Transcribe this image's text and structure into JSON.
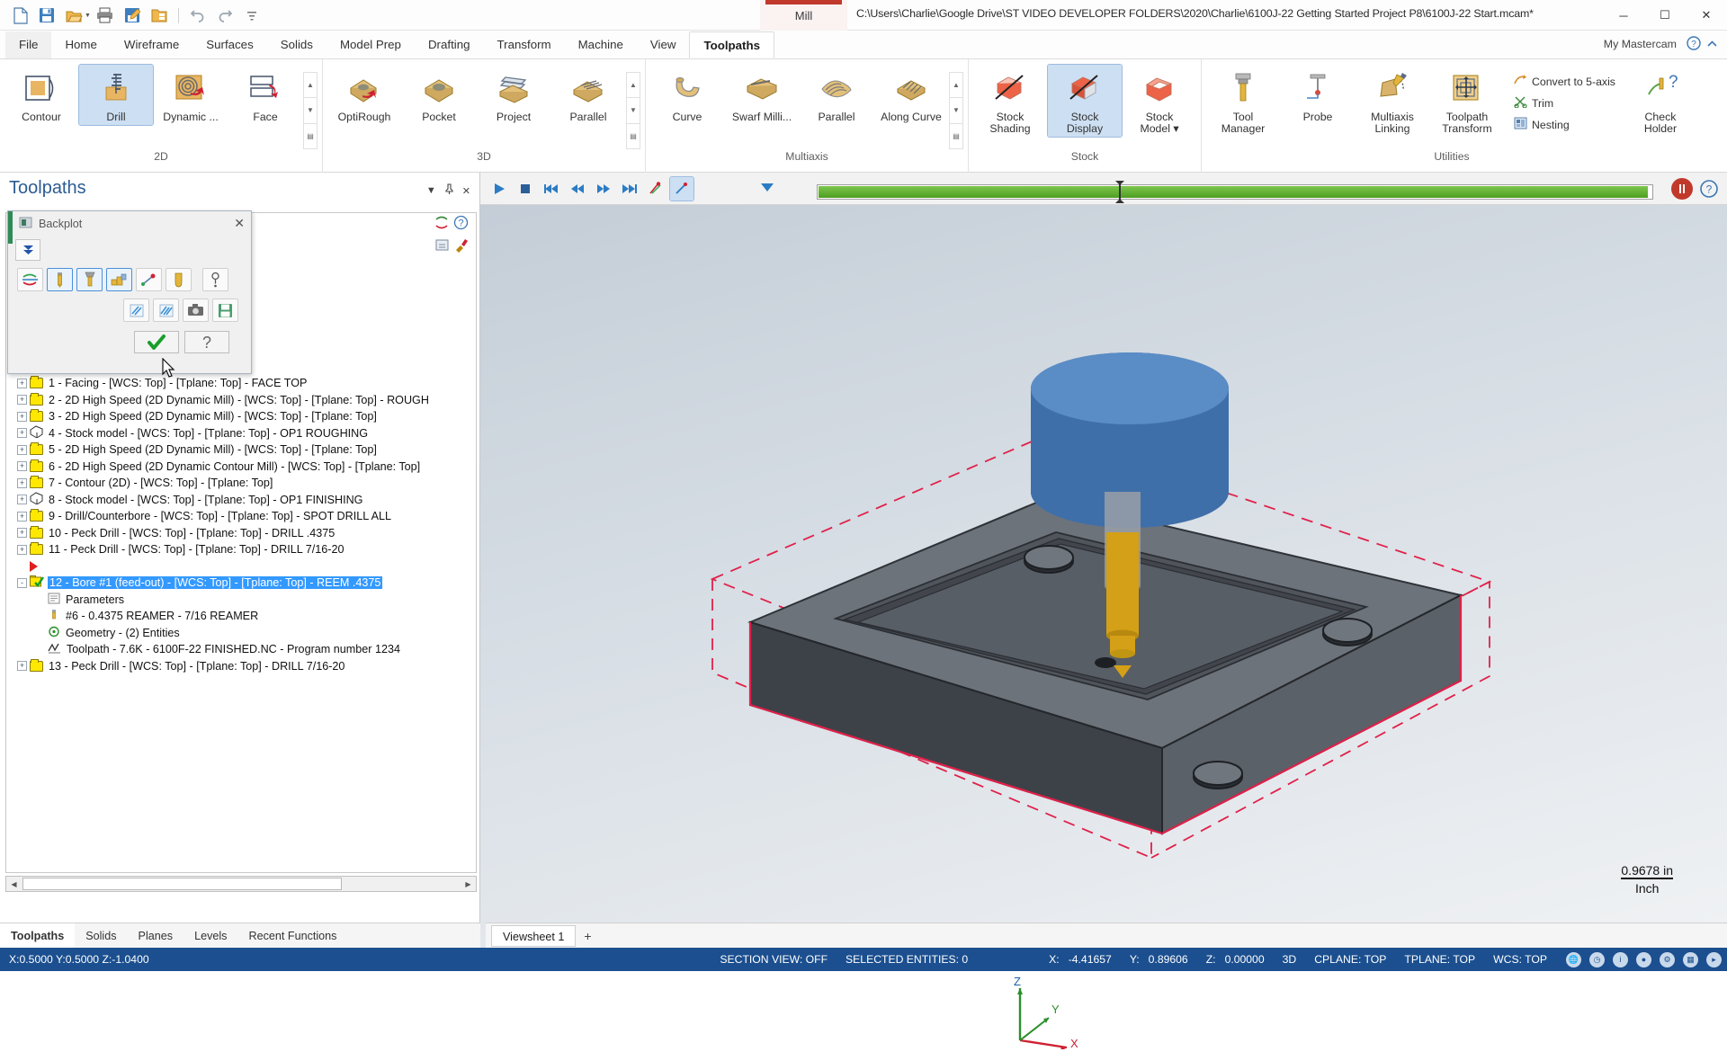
{
  "titlebar": {
    "quick_access": [
      "new-icon",
      "save-icon",
      "open-icon",
      "print-icon",
      "save-as-icon",
      "folder-manage-icon",
      "undo-icon",
      "redo-icon",
      "customize-icon"
    ],
    "mill_tab": "Mill",
    "document_path": "C:\\Users\\Charlie\\Google Drive\\ST VIDEO DEVELOPER FOLDERS\\2020\\Charlie\\6100J-22 Getting Started Project P8\\6100J-22 Start.mcam*",
    "minimize": "─",
    "maximize": "☐",
    "close": "✕"
  },
  "ribbon_tabs": [
    {
      "label": "File",
      "state": "file"
    },
    {
      "label": "Home",
      "state": "normal"
    },
    {
      "label": "Wireframe",
      "state": "normal"
    },
    {
      "label": "Surfaces",
      "state": "normal"
    },
    {
      "label": "Solids",
      "state": "normal"
    },
    {
      "label": "Model Prep",
      "state": "normal"
    },
    {
      "label": "Drafting",
      "state": "normal"
    },
    {
      "label": "Transform",
      "state": "normal"
    },
    {
      "label": "Machine",
      "state": "normal"
    },
    {
      "label": "View",
      "state": "normal"
    },
    {
      "label": "Toolpaths",
      "state": "active"
    }
  ],
  "my_mastercam": "My Mastercam",
  "ribbon_groups": [
    {
      "name": "2D",
      "buttons": [
        {
          "label": "Contour",
          "icon": "contour-icon",
          "selected": false
        },
        {
          "label": "Drill",
          "icon": "drill-icon",
          "selected": true
        },
        {
          "label": "Dynamic ...",
          "icon": "dynamic-mill-icon",
          "selected": false
        },
        {
          "label": "Face",
          "icon": "face-icon",
          "selected": false
        }
      ],
      "has_spinner": true
    },
    {
      "name": "3D",
      "buttons": [
        {
          "label": "OptiRough",
          "icon": "optirough-icon",
          "selected": false
        },
        {
          "label": "Pocket",
          "icon": "pocket-icon",
          "selected": false
        },
        {
          "label": "Project",
          "icon": "project-icon",
          "selected": false
        },
        {
          "label": "Parallel",
          "icon": "parallel-icon",
          "selected": false
        }
      ],
      "has_spinner": true
    },
    {
      "name": "Multiaxis",
      "buttons": [
        {
          "label": "Curve",
          "icon": "curve-icon",
          "selected": false
        },
        {
          "label": "Swarf Milli...",
          "icon": "swarf-milling-icon",
          "selected": false
        },
        {
          "label": "Parallel",
          "icon": "multiaxis-parallel-icon",
          "selected": false
        },
        {
          "label": "Along Curve",
          "icon": "along-curve-icon",
          "selected": false
        }
      ],
      "has_spinner": true
    },
    {
      "name": "Stock",
      "buttons": [
        {
          "label": "Stock Shading",
          "icon": "stock-shading-icon",
          "selected": false
        },
        {
          "label": "Stock Display",
          "icon": "stock-display-icon",
          "selected": true
        },
        {
          "label": "Stock Model ▾",
          "icon": "stock-model-icon",
          "selected": false
        }
      ],
      "has_spinner": false
    },
    {
      "name": "Utilities",
      "buttons": [
        {
          "label": "Tool Manager",
          "icon": "tool-manager-icon",
          "selected": false
        },
        {
          "label": "Probe",
          "icon": "probe-icon",
          "selected": false
        },
        {
          "label": "Multiaxis Linking",
          "icon": "multiaxis-linking-icon",
          "selected": false
        },
        {
          "label": "Toolpath Transform",
          "icon": "toolpath-transform-icon",
          "selected": false
        }
      ],
      "small_items": [
        {
          "label": "Convert to 5-axis",
          "icon": "convert-5axis-icon"
        },
        {
          "label": "Trim",
          "icon": "trim-icon"
        },
        {
          "label": "Nesting",
          "icon": "nesting-icon"
        }
      ],
      "extra_buttons": [
        {
          "label": "Check Holder",
          "icon": "check-holder-icon"
        }
      ],
      "has_spinner": false
    }
  ],
  "toolpaths_panel": {
    "title": "Toolpaths",
    "header_icons": [
      "chevron-down-icon",
      "pin-icon",
      "close-icon"
    ],
    "tree": [
      {
        "level": 0,
        "icon": "folder",
        "plus": "+",
        "label": "1 - Facing - [WCS: Top] - [Tplane: Top] - FACE TOP",
        "selected": false
      },
      {
        "level": 0,
        "icon": "folder",
        "plus": "+",
        "label": "2 - 2D High Speed (2D Dynamic Mill) - [WCS: Top] - [Tplane: Top] - ROUGH",
        "selected": false
      },
      {
        "level": 0,
        "icon": "folder",
        "plus": "+",
        "label": "3 - 2D High Speed (2D Dynamic Mill) - [WCS: Top] - [Tplane: Top]",
        "selected": false
      },
      {
        "level": 0,
        "icon": "stockmodel",
        "plus": "+",
        "label": "4 - Stock model - [WCS: Top] - [Tplane: Top] - OP1 ROUGHING",
        "selected": false
      },
      {
        "level": 0,
        "icon": "folder",
        "plus": "+",
        "label": "5 - 2D High Speed (2D Dynamic Mill) - [WCS: Top] - [Tplane: Top]",
        "selected": false
      },
      {
        "level": 0,
        "icon": "folder",
        "plus": "+",
        "label": "6 - 2D High Speed (2D Dynamic Contour Mill) - [WCS: Top] - [Tplane: Top]",
        "selected": false
      },
      {
        "level": 0,
        "icon": "folder",
        "plus": "+",
        "label": "7 - Contour (2D) - [WCS: Top] - [Tplane: Top]",
        "selected": false
      },
      {
        "level": 0,
        "icon": "stockmodel",
        "plus": "+",
        "label": "8 - Stock model - [WCS: Top] - [Tplane: Top] - OP1 FINISHING",
        "selected": false
      },
      {
        "level": 0,
        "icon": "folder",
        "plus": "+",
        "label": "9 - Drill/Counterbore - [WCS: Top] - [Tplane: Top] - SPOT DRILL ALL",
        "selected": false
      },
      {
        "level": 0,
        "icon": "folder",
        "plus": "+",
        "label": "10 - Peck Drill - [WCS: Top] - [Tplane: Top] - DRILL .4375",
        "selected": false
      },
      {
        "level": 0,
        "icon": "folder",
        "plus": "+",
        "label": "11 - Peck Drill - [WCS: Top] - [Tplane: Top] - DRILL 7/16-20",
        "selected": false
      },
      {
        "level": 0,
        "icon": "redflag",
        "plus": "",
        "label": "",
        "selected": false
      },
      {
        "level": 0,
        "icon": "greencheck",
        "plus": "-",
        "label": "12 - Bore #1 (feed-out) - [WCS: Top] - [Tplane: Top] - REEM .4375",
        "selected": true
      },
      {
        "level": 1,
        "icon": "params",
        "plus": "",
        "label": "Parameters",
        "selected": false
      },
      {
        "level": 1,
        "icon": "tool",
        "plus": "",
        "label": "#6 - 0.4375 REAMER - 7/16 REAMER",
        "selected": false
      },
      {
        "level": 1,
        "icon": "geometry",
        "plus": "",
        "label": "Geometry - (2) Entities",
        "selected": false
      },
      {
        "level": 1,
        "icon": "nc",
        "plus": "",
        "label": "Toolpath - 7.6K - 6100F-22 FINISHED.NC - Program number 1234",
        "selected": false
      },
      {
        "level": 0,
        "icon": "folder",
        "plus": "+",
        "label": "13 - Peck Drill - [WCS: Top] - [Tplane: Top] - DRILL 7/16-20",
        "selected": false
      }
    ]
  },
  "backplot_dialog": {
    "title": "Backplot",
    "title_icon": "backplot-icon",
    "close_label": "✕",
    "expand_icon": "double-chevron-down-icon",
    "row1_buttons": [
      {
        "icon": "toolpath-colorloop-icon",
        "on": false
      },
      {
        "icon": "display-tool-icon",
        "on": true
      },
      {
        "icon": "display-holder-icon",
        "on": true
      },
      {
        "icon": "display-rapid-moves-icon",
        "on": true
      },
      {
        "icon": "endpoints-icon",
        "on": false
      },
      {
        "icon": "tool-profile-icon",
        "on": false
      },
      {
        "icon": "tool-info-icon",
        "on": false
      }
    ],
    "row2_buttons": [
      {
        "icon": "quick-verify-icon"
      },
      {
        "icon": "verify-icon"
      },
      {
        "icon": "camera-snapshot-icon"
      },
      {
        "icon": "save-backplot-icon"
      }
    ],
    "ok_label": "✔",
    "help_label": "?"
  },
  "graphics_toolbar": {
    "buttons": [
      {
        "icon": "play-icon",
        "on": false
      },
      {
        "icon": "stop-icon",
        "on": false
      },
      {
        "icon": "skip-start-icon",
        "on": false
      },
      {
        "icon": "step-back-icon",
        "on": false
      },
      {
        "icon": "step-forward-icon",
        "on": false
      },
      {
        "icon": "skip-end-icon",
        "on": false
      },
      {
        "icon": "toolpath-display-icon",
        "on": false
      },
      {
        "icon": "single-step-icon",
        "on": true
      }
    ],
    "right_icons": [
      {
        "icon": "stop-record-icon",
        "color": "#c0392b"
      },
      {
        "icon": "help-icon",
        "color": "#3b77b5"
      }
    ]
  },
  "viewport": {
    "axis_labels": {
      "z": "Z",
      "y": "Y",
      "x": "X"
    },
    "scale_value": "0.9678 in",
    "scale_unit": "Inch"
  },
  "viewsheet": {
    "tab_label": "Viewsheet 1",
    "add_label": "+"
  },
  "bottom_tabs": [
    {
      "label": "Toolpaths",
      "active": true
    },
    {
      "label": "Solids",
      "active": false
    },
    {
      "label": "Planes",
      "active": false
    },
    {
      "label": "Levels",
      "active": false
    },
    {
      "label": "Recent Functions",
      "active": false
    }
  ],
  "status_bar": {
    "coords": "X:0.5000  Y:0.5000  Z:-1.0400",
    "section_view": "SECTION VIEW: OFF",
    "selected_entities": "SELECTED ENTITIES: 0",
    "x_label": "X:",
    "x_value": "-4.41657",
    "y_label": "Y:",
    "y_value": "0.89606",
    "z_label": "Z:",
    "z_value": "0.00000",
    "mode_3d": "3D",
    "cplane": "CPLANE: TOP",
    "tplane": "TPLANE: TOP",
    "wcs": "WCS: TOP",
    "right_icons": [
      "globe-icon",
      "clock-icon",
      "info-icon",
      "dot-icon",
      "gear-icon",
      "grid-icon",
      "arrow-icon"
    ]
  },
  "colors": {
    "accent_blue": "#2c5c92",
    "selection_blue": "#3399ff",
    "status_bar_bg": "#1b4f8f",
    "mill_red": "#c0392b",
    "folder_yellow": "#ffe800",
    "stock_red": "#e02020",
    "tool_gold": "#d4a017",
    "part_gray": "#4a4f55",
    "tool_blue": "#3f6fa8"
  }
}
